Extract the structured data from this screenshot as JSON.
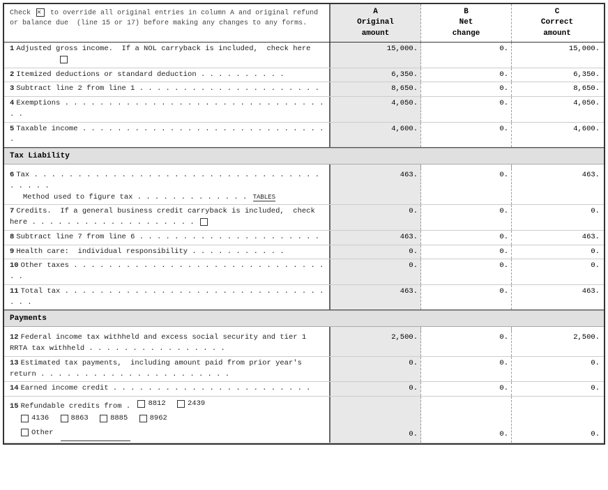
{
  "header": {
    "description": "Check  to override all original entries in column A and original refund or balance due  (line 15 or 17) before making any changes to any forms.",
    "col_a_label": "A\nOriginal\namount",
    "col_b_label": "B\nNet\nchange",
    "col_c_label": "C\nCorrect\namount"
  },
  "sections": [
    {
      "id": "income",
      "rows": [
        {
          "num": "1",
          "desc": "Adjusted gross income.  If a NOL carryback is included,  check here ",
          "has_checkbox": true,
          "a": "15,000.",
          "b": "0.",
          "c": "15,000."
        },
        {
          "num": "2",
          "desc": "Itemized deductions or standard deduction",
          "a": "6,350.",
          "b": "0.",
          "c": "6,350."
        },
        {
          "num": "3",
          "desc": "Subtract line 2 from line 1",
          "a": "8,650.",
          "b": "0.",
          "c": "8,650."
        },
        {
          "num": "4",
          "desc": "Exemptions",
          "a": "4,050.",
          "b": "0.",
          "c": "4,050."
        },
        {
          "num": "5",
          "desc": "Taxable income",
          "a": "4,600.",
          "b": "0.",
          "c": "4,600."
        }
      ]
    },
    {
      "id": "tax_liability",
      "header": "Tax Liability",
      "rows": [
        {
          "num": "6",
          "desc": "Tax",
          "a": "463.",
          "b": "0.",
          "c": "463.",
          "sub": "Method used to figure tax",
          "sub_label": "TABLES"
        },
        {
          "num": "7",
          "desc": "Credits.  If a general business credit carryback is included,  check here ",
          "has_checkbox": true,
          "a": "0.",
          "b": "0.",
          "c": "0."
        },
        {
          "num": "8",
          "desc": "Subtract line 7 from line 6",
          "a": "463.",
          "b": "0.",
          "c": "463."
        },
        {
          "num": "9",
          "desc": "Health care:  individual responsibility",
          "a": "0.",
          "b": "0.",
          "c": "0."
        },
        {
          "num": "10",
          "desc": "Other taxes",
          "a": "0.",
          "b": "0.",
          "c": "0."
        },
        {
          "num": "11",
          "desc": "Total tax",
          "a": "463.",
          "b": "0.",
          "c": "463."
        }
      ]
    },
    {
      "id": "payments",
      "header": "Payments",
      "rows": [
        {
          "num": "12",
          "desc": "Federal income tax withheld and excess social security and tier 1 RRTA tax withheld",
          "a": "2,500.",
          "b": "0.",
          "c": "2,500."
        },
        {
          "num": "13",
          "desc": "Estimated tax payments,  including amount paid from prior year's return",
          "a": "0.",
          "b": "0.",
          "c": "0."
        },
        {
          "num": "14",
          "desc": "Earned income credit",
          "a": "0.",
          "b": "0.",
          "c": "0."
        },
        {
          "num": "15",
          "desc": "Refundable credits from",
          "is_refundable": true,
          "a": "0.",
          "b": "0.",
          "c": "0.",
          "checkboxes": [
            "8812",
            "2439",
            "4136",
            "8863",
            "8885",
            "8962",
            "Other"
          ]
        }
      ]
    }
  ]
}
